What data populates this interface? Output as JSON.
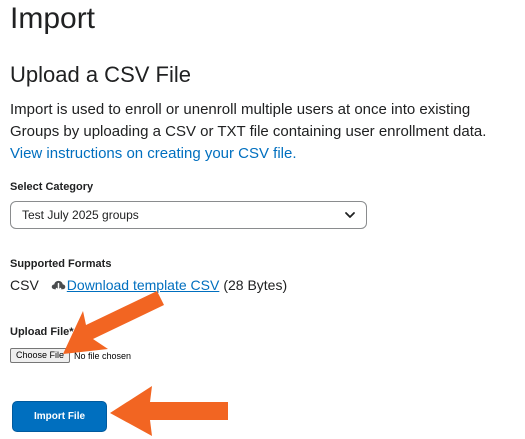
{
  "page": {
    "title": "Import"
  },
  "upload": {
    "heading": "Upload a CSV File",
    "intro_text": "Import is used to enroll or unenroll multiple users at once into existing Groups by uploading a CSV or TXT file containing user enrollment data.",
    "instructions_link": "View instructions on creating your CSV file."
  },
  "category": {
    "label": "Select Category",
    "selected": "Test July 2025 groups"
  },
  "formats": {
    "label": "Supported Formats",
    "format": "CSV",
    "download_link": "Download template CSV",
    "size": "(28 Bytes)"
  },
  "file": {
    "label": "Upload File*",
    "choose_button": "Choose File",
    "status": "No file chosen"
  },
  "actions": {
    "import_button": "Import File"
  },
  "annotations": {
    "arrow_color": "#f26522"
  },
  "colors": {
    "link": "#006fbf",
    "primary_button": "#006fbf"
  }
}
